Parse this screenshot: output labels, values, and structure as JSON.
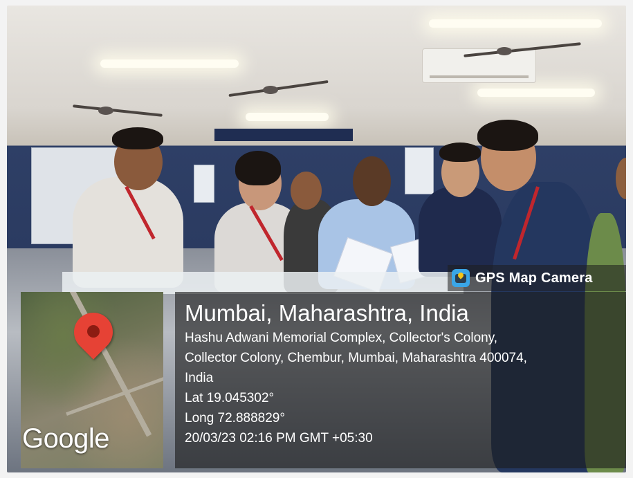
{
  "badge": {
    "label": "GPS Map Camera"
  },
  "map": {
    "attribution": "Google"
  },
  "location": {
    "title": "Mumbai, Maharashtra, India",
    "address_lines": [
      "Hashu Adwani Memorial Complex, Collector's Colony,",
      "Collector Colony, Chembur, Mumbai, Maharashtra 400074,",
      "India"
    ],
    "lat": "Lat 19.045302°",
    "long": "Long 72.888829°",
    "timestamp": "20/03/23 02:16 PM GMT +05:30"
  },
  "colors": {
    "pin": "#e64235",
    "overlay": "#1c1c1c",
    "badge_icon": "#3aa6e8"
  },
  "icons": {
    "badge": "gps-map-camera-icon",
    "pin": "map-pin-icon"
  }
}
